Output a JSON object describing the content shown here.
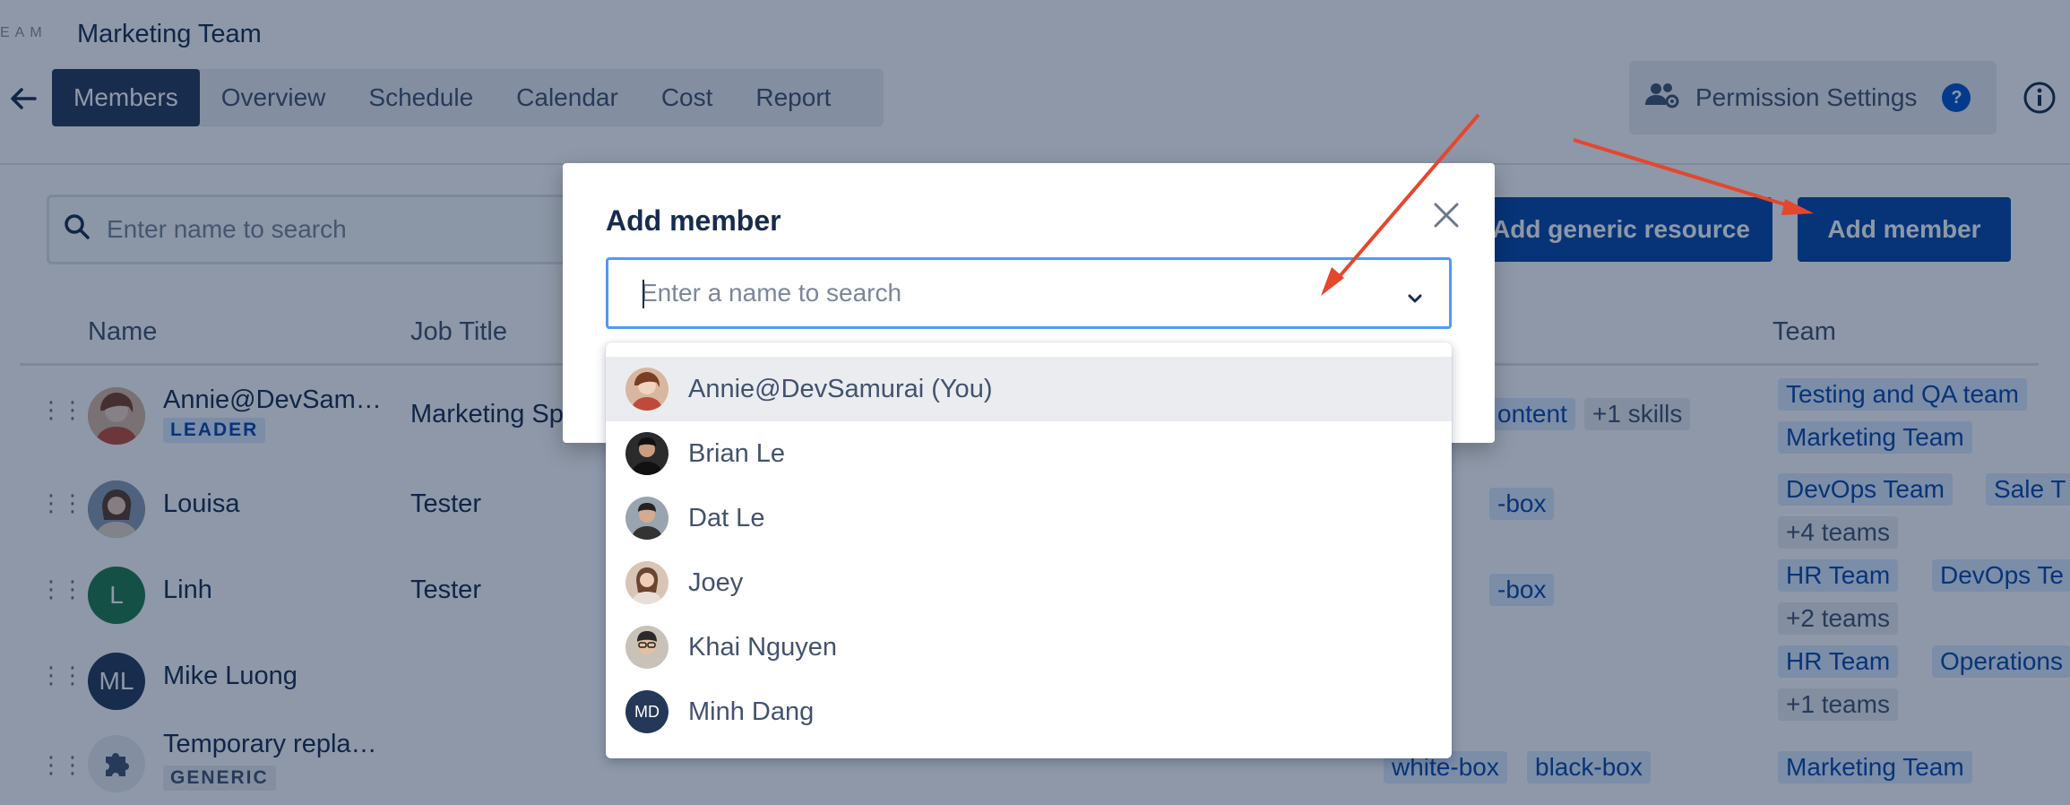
{
  "header": {
    "team_label": "EAM",
    "team_name": "Marketing Team"
  },
  "tabs": [
    {
      "label": "Members",
      "active": true
    },
    {
      "label": "Overview"
    },
    {
      "label": "Schedule"
    },
    {
      "label": "Calendar"
    },
    {
      "label": "Cost"
    },
    {
      "label": "Report"
    }
  ],
  "toolbar": {
    "permission_label": "Permission Settings",
    "help_badge": "?",
    "search_placeholder": "Enter name to search",
    "add_generic_label": "Add generic resource",
    "add_member_label": "Add member"
  },
  "table": {
    "headers": {
      "name": "Name",
      "job_title": "Job Title",
      "team": "Team"
    },
    "rows": [
      {
        "name": "Annie@DevSam…",
        "badge": "LEADER",
        "job_title": "Marketing Sp",
        "skills": [
          "ontent",
          "+1 skills"
        ],
        "teams": [
          "Testing and QA team",
          "Marketing Team"
        ]
      },
      {
        "name": "Louisa",
        "job_title": "Tester",
        "skills": [
          "-box"
        ],
        "teams": [
          "DevOps Team",
          "Sale T",
          "+4 teams"
        ]
      },
      {
        "name": "Linh",
        "initials": "L",
        "job_title": "Tester",
        "skills": [
          "-box"
        ],
        "teams": [
          "HR Team",
          "DevOps Te",
          "+2 teams"
        ]
      },
      {
        "name": "Mike Luong",
        "initials": "ML",
        "job_title": "",
        "skills": [],
        "teams": [
          "HR Team",
          "Operations",
          "+1 teams"
        ]
      },
      {
        "name": "Temporary repla…",
        "badge": "GENERIC",
        "job_title": "",
        "skills": [
          "white-box",
          "black-box"
        ],
        "teams": [
          "Marketing Team"
        ]
      }
    ]
  },
  "modal": {
    "title": "Add member",
    "select_placeholder": "Enter a name to search",
    "options": [
      {
        "label": "Annie@DevSamurai (You)",
        "highlighted": true
      },
      {
        "label": "Brian Le"
      },
      {
        "label": "Dat Le"
      },
      {
        "label": "Joey"
      },
      {
        "label": "Khai Nguyen"
      },
      {
        "label": "Minh Dang",
        "initials": "MD"
      }
    ]
  },
  "colors": {
    "primary": "#0747A6",
    "tab_active": "#253858",
    "focus_border": "#4C9AFF",
    "annotation_arrow": "#E5462E"
  }
}
